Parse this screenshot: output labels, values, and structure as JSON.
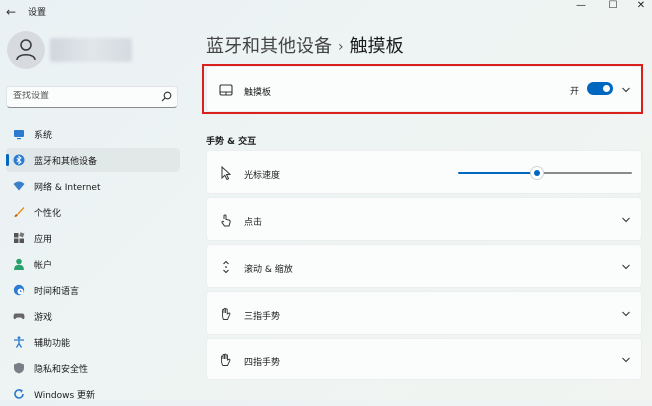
{
  "window": {
    "title": "设置",
    "minimize": "—",
    "maximize": "☐",
    "close": "✕"
  },
  "search": {
    "placeholder": "查找设置"
  },
  "sidebar": {
    "items": [
      {
        "label": "系统",
        "icon": "monitor-icon"
      },
      {
        "label": "蓝牙和其他设备",
        "icon": "bluetooth-icon",
        "active": true
      },
      {
        "label": "网络 & Internet",
        "icon": "wifi-icon"
      },
      {
        "label": "个性化",
        "icon": "brush-icon"
      },
      {
        "label": "应用",
        "icon": "apps-icon"
      },
      {
        "label": "帐户",
        "icon": "person-icon"
      },
      {
        "label": "时间和语言",
        "icon": "globe-clock-icon"
      },
      {
        "label": "游戏",
        "icon": "gamepad-icon"
      },
      {
        "label": "辅助功能",
        "icon": "accessibility-icon"
      },
      {
        "label": "隐私和安全性",
        "icon": "shield-icon"
      },
      {
        "label": "Windows 更新",
        "icon": "update-icon"
      }
    ]
  },
  "breadcrumb": {
    "parent": "蓝牙和其他设备",
    "separator": "›",
    "current": "触摸板"
  },
  "touchpad_card": {
    "label": "触摸板",
    "state_label": "开",
    "enabled": true
  },
  "section_title": "手势 & 交互",
  "cursor_speed": {
    "label": "光标速度",
    "value_fraction": 0.45
  },
  "gesture_cards": [
    {
      "label": "点击",
      "icon": "tap-icon"
    },
    {
      "label": "滚动 & 缩放",
      "icon": "scroll-icon"
    },
    {
      "label": "三指手势",
      "icon": "three-finger-hand-icon"
    },
    {
      "label": "四指手势",
      "icon": "four-finger-hand-icon"
    }
  ],
  "colors": {
    "accent": "#0067c0",
    "highlight_border": "#d9201c"
  }
}
